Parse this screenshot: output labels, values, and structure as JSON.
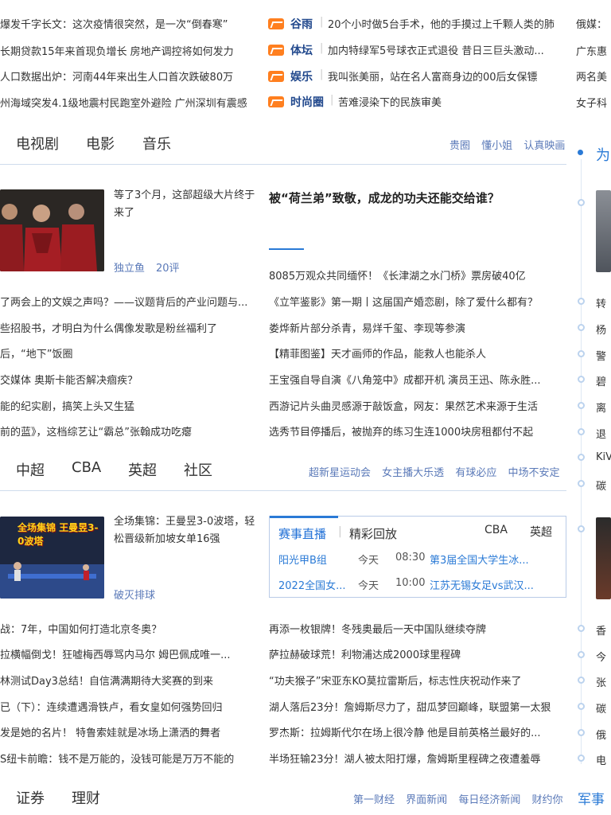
{
  "top_news_left": [
    "爆发千字长文：这次疫情很突然，是一次“倒春寒”",
    "长期贷款15年来首现负增长 房地产调控将如何发力",
    "人口数据出炉：河南44年来出生人口首次跌破80万",
    "州海域突发4.1级地震村民跑室外避险 广州深圳有震感"
  ],
  "top_news_mid": [
    {
      "cat": "谷雨",
      "text": "20个小时做5台手术，他的手摸过上千颗人类的肺"
    },
    {
      "cat": "体坛",
      "text": "加内特绿军5号球衣正式退役 昔日三巨头激动..."
    },
    {
      "cat": "娱乐",
      "text": "我叫张美丽，站在名人富商身边的00后女保镖"
    },
    {
      "cat": "时尚圈",
      "text": "苦难浸染下的民族审美"
    }
  ],
  "top_news_right": [
    "俄媒：",
    "广东惠",
    "两名美",
    "女子科"
  ],
  "ent": {
    "tabs": [
      "电视剧",
      "电影",
      "音乐"
    ],
    "links": [
      "贵圈",
      "懂小姐",
      "认真映画"
    ],
    "feature_title": "等了3个月，这部超级大片终于来了",
    "feature_source": "独立鱼",
    "feature_comments": "20评",
    "headline": "被“荷兰弟”致敬，成龙的功夫还能交给谁？",
    "left_list": [
      "了两会上的文娱之声吗？——议题背后的产业问题与...",
      "些招股书，才明白为什么偶像发歌是粉丝福利了",
      "后，“地下”饭圈",
      "交媒体 奥斯卡能否解决痼疾？",
      "能的纪实剧，搞笑上头又生猛",
      "前的蓝》，这档综艺让“霸总”张翰成功吃瘪"
    ],
    "right_list": [
      "8085万观众共同缅怀！《长津湖之水门桥》票房破40亿",
      "《立竿鉴影》第一期丨这届国产婚恋剧，除了爱什么都有？",
      "娄烨新片部分杀青，易烊千玺、李现等参演",
      "【精菲图鉴】天才画师的作品，能救人也能杀人",
      "王宝强自导自演《八角笼中》成都开机 演员王迅、陈永胜...",
      "西游记片头曲灵感源于敲饭盒，网友：果然艺术来源于生活",
      "选秀节目停播后，被抛弃的练习生连1000块房租都付不起"
    ]
  },
  "sports": {
    "tabs": [
      "中超",
      "CBA",
      "英超",
      "社区"
    ],
    "links": [
      "超新星运动会",
      "女主播大乐透",
      "有球必应",
      "中场不安定"
    ],
    "thumb_text": "全场集锦 王曼昱3-0波塔",
    "feature_title": "全场集锦：王曼昱3-0波塔，轻松晋级新加坡女单16强",
    "feature_source": "破灭排球",
    "live_tabs": [
      "赛事直播",
      "精彩回放"
    ],
    "live_links": [
      "CBA",
      "英超"
    ],
    "live_rows": [
      {
        "team": "阳光甲B组",
        "day": "今天",
        "time": "08:30",
        "match": "第3届全国大学生冰..."
      },
      {
        "team": "2022全国女...",
        "day": "今天",
        "time": "10:00",
        "match": "江苏无锡女足vs武汉..."
      }
    ],
    "left_list": [
      "战：7年，中国如何打造北京冬奥？",
      "拉横幅倒戈！狂嘘梅西辱骂内马尔 姆巴佩成唯一...",
      "林测试Day3总结！自信满满期待大奖赛的到来",
      "已（下）：连续遭遇滑铁卢，看女皇如何强势回归",
      "发是她的名片！ 特鲁索娃就是冰场上潇洒的舞者",
      "S纽卡前瞻：钱不是万能的，没钱可能是万万不能的"
    ],
    "right_list": [
      "再添一枚银牌！冬残奥最后一天中国队继续夺牌",
      "萨拉赫破球荒！利物浦达成2000球里程碑",
      "“功夫猴子”宋亚东KO莫拉雷斯后，标志性庆祝动作来了",
      "湖人落后23分！詹姆斯尽力了，甜瓜梦回巅峰，联盟第一太狠",
      "罗杰斯：拉姆斯代尔在场上很冷静 他是目前英格兰最好的...",
      "半场狂输23分！湖人被太阳打爆，詹姆斯里程碑之夜遭羞辱"
    ]
  },
  "finance": {
    "tabs": [
      "证券",
      "理财"
    ],
    "links": [
      "第一财经",
      "界面新闻",
      "每日经济新闻",
      "财约你"
    ]
  },
  "sidebar": {
    "header": "为",
    "items_a": [
      "转",
      "杨",
      "警",
      "碧",
      "离",
      "退",
      "KiV",
      "碳"
    ],
    "items_b": [
      "香",
      "今",
      "张",
      "碳",
      "俄",
      "电"
    ],
    "bottom": "军事"
  }
}
